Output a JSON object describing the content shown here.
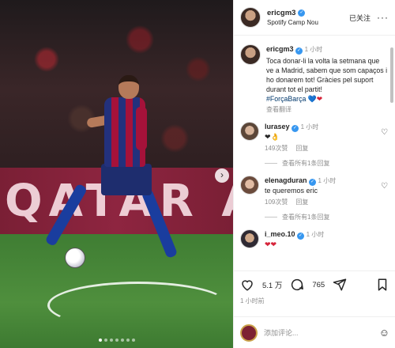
{
  "photo": {
    "banner_text": "QATAR AIRWA",
    "next_arrow": "›",
    "dots": 7,
    "active_dot": 0
  },
  "header": {
    "username": "ericgm3",
    "location": "Spotify Camp Nou",
    "follow_label": "已关注",
    "more": "···"
  },
  "caption": {
    "username": "ericgm3",
    "time": "1 小时",
    "text": "Toca donar-li la volta la setmana que ve a Madrid, sabem que som capaços i ho donarem tot! Gràcies pel suport durant tot el partit!",
    "hashtag": "#ForçaBarça",
    "hearts": [
      "💙",
      "❤"
    ],
    "translate": "查看翻译"
  },
  "comments": [
    {
      "username": "lurasey",
      "time": "1 小时",
      "text": "❤👌",
      "likes": "149次赞",
      "reply_label": "回复",
      "view_replies": "查看所有1条回复"
    },
    {
      "username": "elenagduran",
      "time": "1 小时",
      "text": "te queremos eric",
      "likes": "109次赞",
      "reply_label": "回复",
      "view_replies": "查看所有1条回复"
    },
    {
      "username": "i_meo.10",
      "time": "1 小时",
      "text": "❤❤"
    }
  ],
  "actions": {
    "likes": "5.1 万",
    "comments": "765",
    "time": "1 小时前"
  },
  "add_comment": {
    "placeholder": "添加评论...",
    "emoji": "☺"
  },
  "colors": {
    "verified": "#3797f0",
    "hashtag": "#00376b",
    "muted": "#8e8e8e"
  }
}
